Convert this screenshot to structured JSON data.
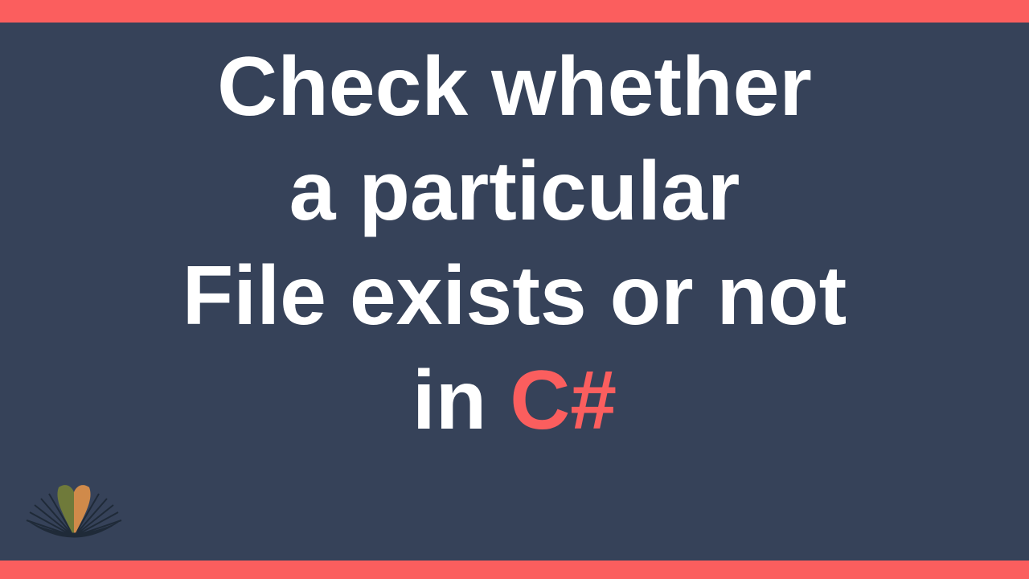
{
  "title": {
    "line1": "Check whether",
    "line2": "a particular",
    "line3": "File exists or not",
    "line4_prefix": "in ",
    "line4_highlight": "C#"
  },
  "icons": {
    "logo": "open-book-icon"
  },
  "colors": {
    "background": "#364259",
    "accent": "#fb5e5e",
    "text": "#ffffff"
  }
}
